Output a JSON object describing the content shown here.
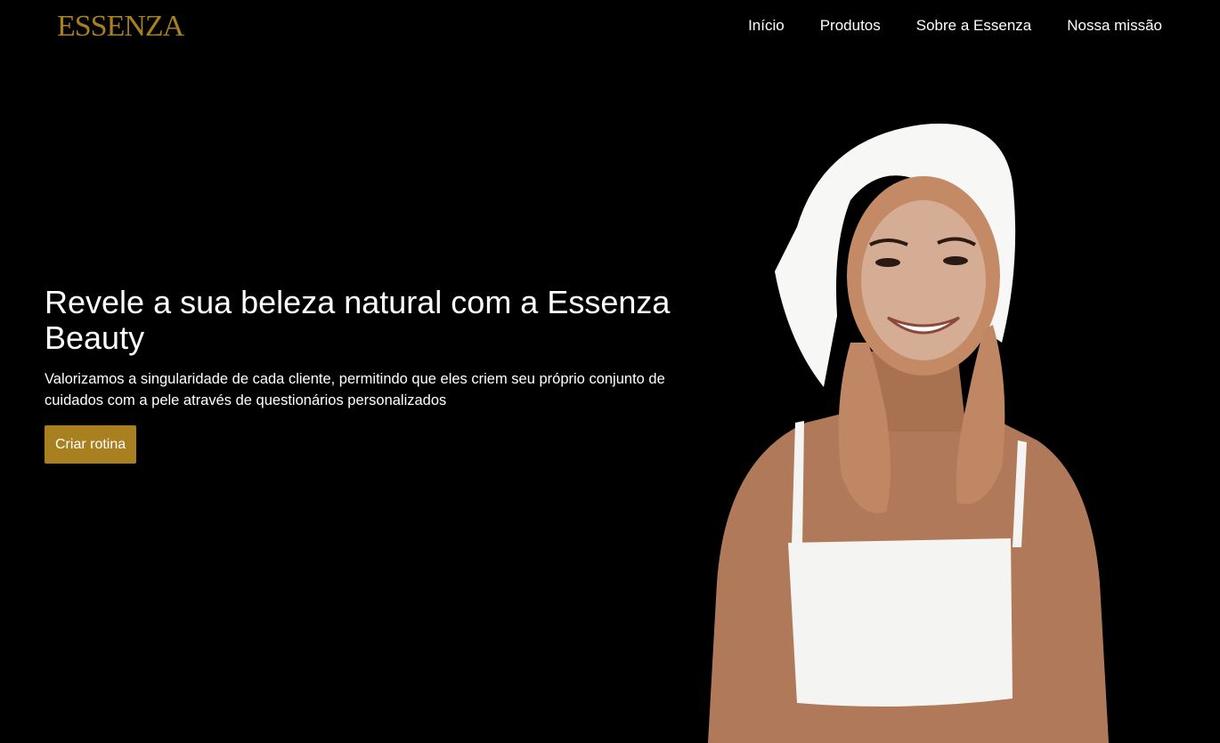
{
  "brand": {
    "logo_text": "ESSENZA",
    "gold_color": "#a8801f"
  },
  "nav": {
    "items": [
      {
        "label": "Início"
      },
      {
        "label": "Produtos"
      },
      {
        "label": "Sobre a Essenza"
      },
      {
        "label": "Nossa missão"
      }
    ]
  },
  "hero": {
    "title": "Revele a sua beleza natural com a Essenza Beauty",
    "subtitle": "Valorizamos a singularidade de cada cliente, permitindo que eles criem seu próprio conjunto de cuidados com a pele através de questionários personalizados",
    "cta_label": "Criar rotina",
    "cta_color": "#a8801f"
  },
  "colors": {
    "background": "#000000",
    "text": "#ffffff"
  }
}
